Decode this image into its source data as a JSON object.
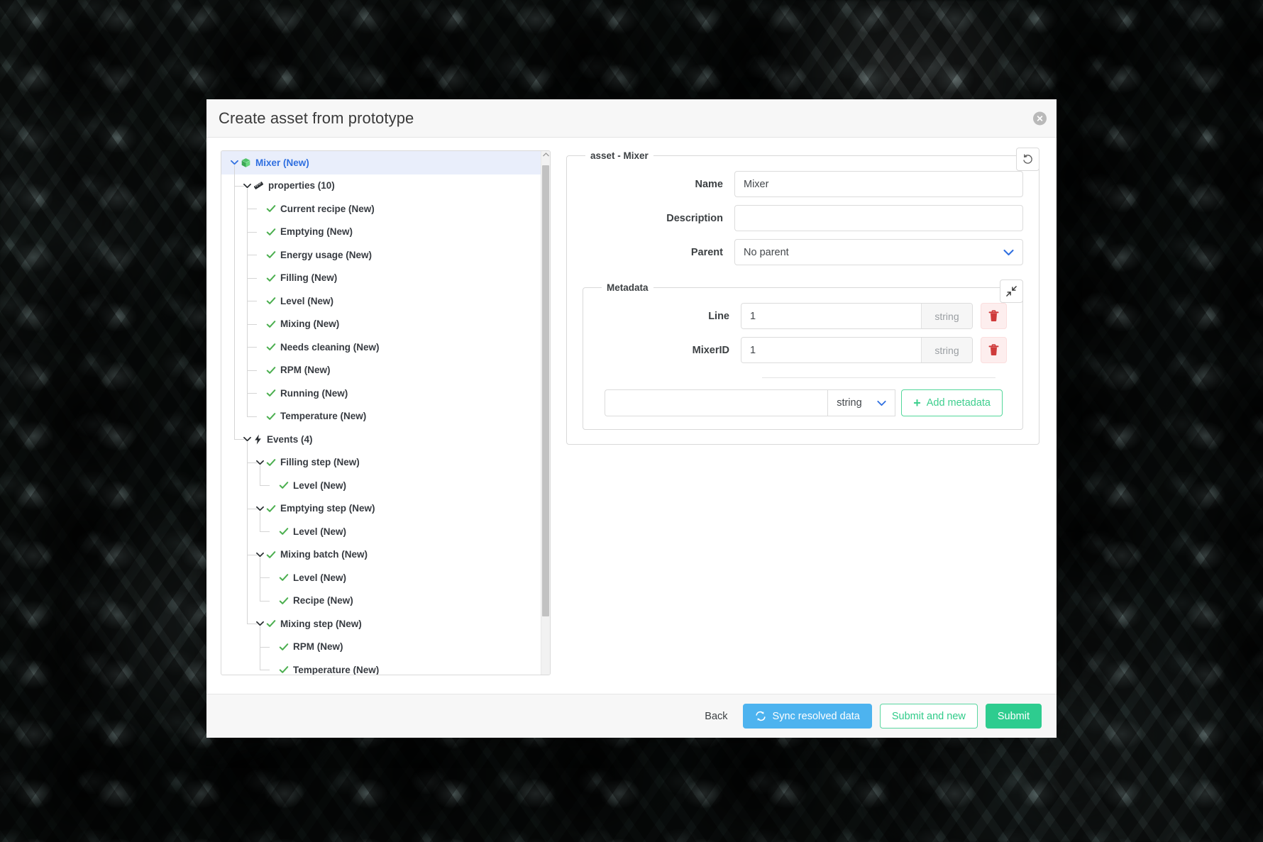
{
  "dialog": {
    "title": "Create asset from prototype",
    "close_icon": "close-icon"
  },
  "tree": {
    "nodes": [
      {
        "label": "Mixer (New)",
        "depth": 0,
        "icon": "cube-icon",
        "caret": "down",
        "root": true
      },
      {
        "label": "properties (10)",
        "depth": 1,
        "icon": "ruler-icon",
        "caret": "down"
      },
      {
        "label": "Current recipe (New)",
        "depth": 2,
        "icon": "check-icon",
        "caret": "none"
      },
      {
        "label": "Emptying (New)",
        "depth": 2,
        "icon": "check-icon",
        "caret": "none"
      },
      {
        "label": "Energy usage (New)",
        "depth": 2,
        "icon": "check-icon",
        "caret": "none"
      },
      {
        "label": "Filling (New)",
        "depth": 2,
        "icon": "check-icon",
        "caret": "none"
      },
      {
        "label": "Level (New)",
        "depth": 2,
        "icon": "check-icon",
        "caret": "none"
      },
      {
        "label": "Mixing (New)",
        "depth": 2,
        "icon": "check-icon",
        "caret": "none"
      },
      {
        "label": "Needs cleaning (New)",
        "depth": 2,
        "icon": "check-icon",
        "caret": "none"
      },
      {
        "label": "RPM (New)",
        "depth": 2,
        "icon": "check-icon",
        "caret": "none"
      },
      {
        "label": "Running (New)",
        "depth": 2,
        "icon": "check-icon",
        "caret": "none"
      },
      {
        "label": "Temperature (New)",
        "depth": 2,
        "icon": "check-icon",
        "caret": "none"
      },
      {
        "label": "Events (4)",
        "depth": 1,
        "icon": "lightning-icon",
        "caret": "down"
      },
      {
        "label": "Filling step (New)",
        "depth": 2,
        "icon": "check-icon",
        "caret": "down"
      },
      {
        "label": "Level (New)",
        "depth": 3,
        "icon": "check-icon",
        "caret": "none"
      },
      {
        "label": "Emptying step (New)",
        "depth": 2,
        "icon": "check-icon",
        "caret": "down"
      },
      {
        "label": "Level (New)",
        "depth": 3,
        "icon": "check-icon",
        "caret": "none"
      },
      {
        "label": "Mixing batch (New)",
        "depth": 2,
        "icon": "check-icon",
        "caret": "down"
      },
      {
        "label": "Level (New)",
        "depth": 3,
        "icon": "check-icon",
        "caret": "none"
      },
      {
        "label": "Recipe (New)",
        "depth": 3,
        "icon": "check-icon",
        "caret": "none"
      },
      {
        "label": "Mixing step (New)",
        "depth": 2,
        "icon": "check-icon",
        "caret": "down"
      },
      {
        "label": "RPM (New)",
        "depth": 3,
        "icon": "check-icon",
        "caret": "none"
      },
      {
        "label": "Temperature (New)",
        "depth": 3,
        "icon": "check-icon",
        "caret": "none"
      }
    ]
  },
  "asset_form": {
    "legend": "asset - Mixer",
    "reset_icon": "undo-icon",
    "fields": [
      {
        "label": "Name",
        "value": "Mixer",
        "placeholder": "",
        "type": "text"
      },
      {
        "label": "Description",
        "value": "",
        "placeholder": "",
        "type": "text"
      },
      {
        "label": "Parent",
        "value": "No parent",
        "type": "select"
      }
    ]
  },
  "metadata": {
    "legend": "Metadata",
    "collapse_icon": "collapse-icon",
    "rows": [
      {
        "label": "Line",
        "value": "1",
        "type": "string",
        "delete_icon": "trash-icon"
      },
      {
        "label": "MixerID",
        "value": "1",
        "type": "string",
        "delete_icon": "trash-icon"
      }
    ],
    "add": {
      "name_value": "",
      "name_placeholder": "",
      "type_value": "string",
      "button_label": "Add metadata",
      "plus": "+"
    }
  },
  "footer": {
    "back_label": "Back",
    "sync_label": "Sync resolved data",
    "sync_icon": "sync-icon",
    "submit_new_label": "Submit and new",
    "submit_label": "Submit"
  },
  "colors": {
    "accent_blue": "#2f6fe0",
    "sync_blue": "#4db3ef",
    "green": "#2ecc8f",
    "check_green": "#4caf50",
    "danger_red": "#d9534f"
  }
}
